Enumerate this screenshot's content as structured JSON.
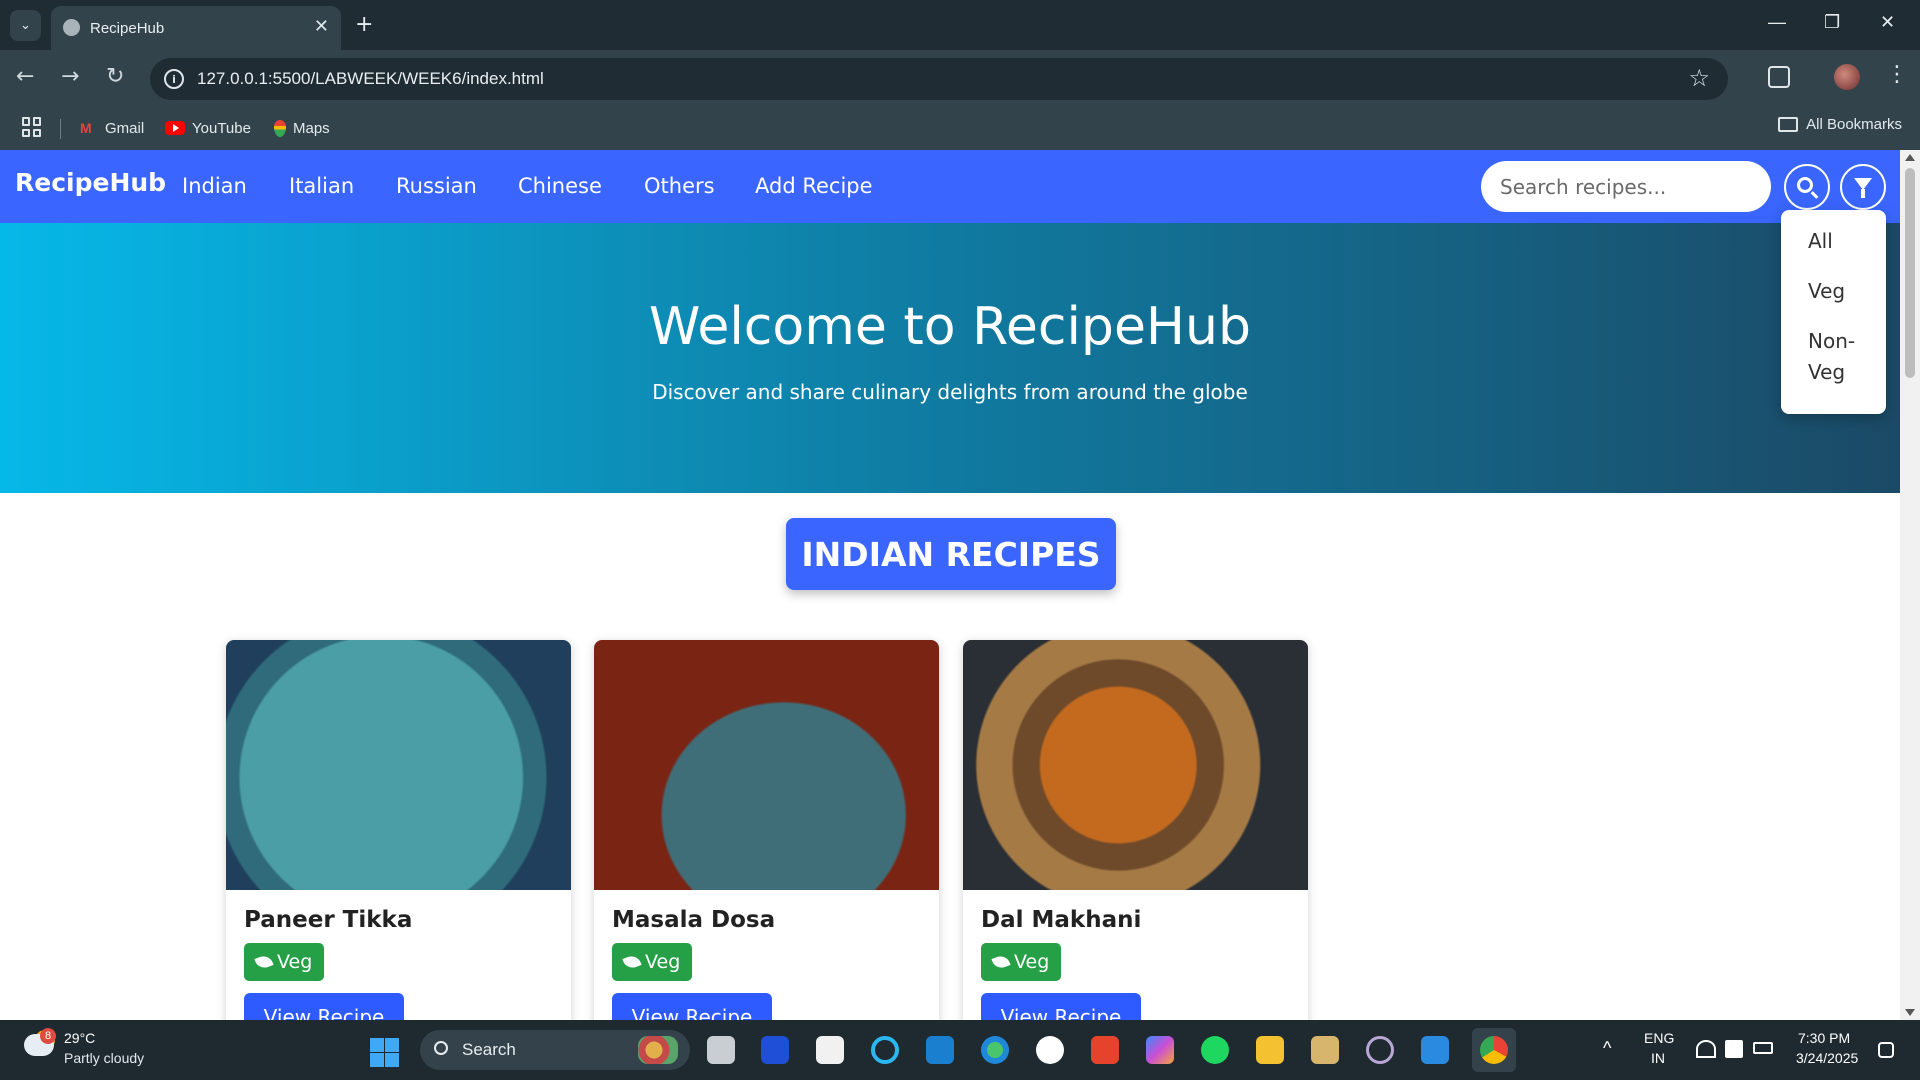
{
  "browser": {
    "tab_title": "RecipeHub",
    "tab_close": "✕",
    "new_tab": "+",
    "url": "127.0.0.1:5500/LABWEEK/WEEK6/index.html",
    "win_min": "—",
    "win_restore": "❐",
    "win_close": "✕",
    "back": "←",
    "forward": "→",
    "reload": "↻",
    "star": "☆",
    "menu": "⋮",
    "tab_menu": "⌄",
    "bookmarks": [
      {
        "label": "Gmail",
        "icon": "gmail-icon"
      },
      {
        "label": "YouTube",
        "icon": "youtube-icon"
      },
      {
        "label": "Maps",
        "icon": "maps-icon"
      }
    ],
    "all_bookmarks": "All Bookmarks"
  },
  "site": {
    "brand": "RecipeHub",
    "nav": [
      "Indian",
      "Italian",
      "Russian",
      "Chinese",
      "Others",
      "Add Recipe"
    ],
    "search_placeholder": "Search recipes...",
    "accent_color": "#3a66ff",
    "filter_menu": [
      "All",
      "Veg",
      "Non-",
      "Veg"
    ],
    "hero": {
      "title": "Welcome to RecipeHub",
      "subtitle": "Discover and share culinary delights from around the globe"
    },
    "section_title": "INDIAN RECIPES",
    "recipes": [
      {
        "name": "Paneer Tikka",
        "badge": "Veg",
        "button": "View Recipe"
      },
      {
        "name": "Masala Dosa",
        "badge": "Veg",
        "button": "View Recipe"
      },
      {
        "name": "Dal Makhani",
        "badge": "Veg",
        "button": "View Recipe"
      }
    ],
    "badge_color": "#26a047"
  },
  "taskbar": {
    "weather_badge": "8",
    "temperature": "29°C",
    "weather": "Partly cloudy",
    "search": "Search",
    "language": "ENG",
    "region": "IN",
    "time": "7:30 PM",
    "date": "3/24/2025",
    "tray_chevron": "^"
  }
}
